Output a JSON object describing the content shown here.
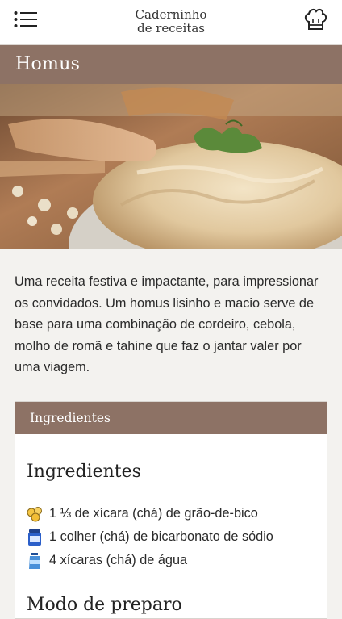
{
  "header": {
    "app_title_line1": "Caderninho",
    "app_title_line2": "de receitas",
    "menu_icon": "hamburger-list-icon",
    "chef_icon": "chef-hat-icon"
  },
  "recipe": {
    "title": "Homus",
    "intro": "Uma receita festiva e impactante, para impressionar os convidados. Um homus lisinho e macio serve de base para uma combinação de cordeiro, cebola, molho de romã e tahine que faz o jantar valer por uma viagem."
  },
  "card": {
    "header_label": "Ingredientes",
    "ingredients_title": "Ingredientes",
    "ingredients": [
      {
        "icon": "chickpeas-icon",
        "text": "1 ⅓ de xícara (chá) de grão-de-bico"
      },
      {
        "icon": "baking-soda-jar-icon",
        "text": "1 colher (chá) de bicarbonato de sódio"
      },
      {
        "icon": "water-bottle-icon",
        "text": "4 xícaras (chá) de água"
      }
    ],
    "method_title": "Modo de preparo"
  },
  "colors": {
    "accent": "#8d7265",
    "background": "#f3f2ef"
  }
}
